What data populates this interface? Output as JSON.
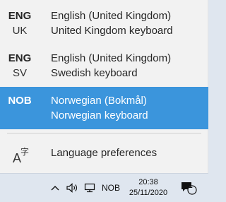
{
  "languages": [
    {
      "code": "ENG",
      "sub": "UK",
      "name": "English (United Kingdom)",
      "keyboard": "United Kingdom keyboard"
    },
    {
      "code": "ENG",
      "sub": "SV",
      "name": "English (United Kingdom)",
      "keyboard": "Swedish keyboard"
    },
    {
      "code": "NOB",
      "sub": "",
      "name": "Norwegian (Bokmål)",
      "keyboard": "Norwegian keyboard"
    }
  ],
  "preferences": {
    "label": "Language preferences",
    "icon": "language-settings-icon"
  },
  "taskbar": {
    "chevron": "^",
    "lang_code": "NOB",
    "time": "20:38",
    "date": "25/11/2020",
    "notification_count": "1"
  },
  "colors": {
    "selected_bg": "#3b95dc",
    "flyout_bg": "#f2f2f2",
    "taskbar_bg": "#dfe6ef"
  }
}
